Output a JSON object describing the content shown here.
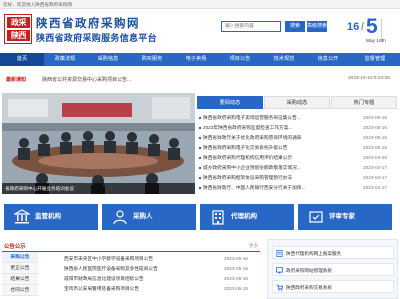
{
  "topbar": {
    "text": "您好，欢迎进入陕西省政府采购网"
  },
  "header": {
    "logo_line1": "政采",
    "logo_line2": "陕西",
    "title_line1": "陕西省政府采购网",
    "title_line2": "陕西省政府采购服务信息平台",
    "search_placeholder": "输入搜索内容",
    "search_button": "搜索",
    "advanced_button": "高级搜索",
    "month": "16",
    "day": "5",
    "date_string": "May 16th"
  },
  "nav": {
    "items": [
      {
        "label": "首页"
      },
      {
        "label": "政策法规"
      },
      {
        "label": "采购信息"
      },
      {
        "label": "购买服务"
      },
      {
        "label": "电子卖场"
      },
      {
        "label": "项目公告"
      },
      {
        "label": "技术规范"
      },
      {
        "label": "信息公开"
      },
      {
        "label": "监督管理"
      }
    ]
  },
  "notice": {
    "label": "最新通知",
    "text": "陕西省公共资源交易中心采购项目公告...",
    "time": "2023-10-10 9:24:35"
  },
  "photo": {
    "caption": "省政府采购中心开展业务培训会议"
  },
  "tabs": [
    {
      "label": "要闻动态"
    },
    {
      "label": "采购动态"
    },
    {
      "label": "热门专题"
    }
  ],
  "news": [
    {
      "title": "陕西省政府采购电子卖场运营服务商征集公告...",
      "date": "2023-05-16"
    },
    {
      "title": "2023年陕西省政府采购监督检查工作方案...",
      "date": "2023-05-16"
    },
    {
      "title": "陕西省财政厅关于优化政府采购营商环境的通知",
      "date": "2023-05-15"
    },
    {
      "title": "陕西省政府采购电子化交易系统升级公告",
      "date": "2023-05-15"
    },
    {
      "title": "陕西省政府采购代理机构信用评价结果公示",
      "date": "2023-04-28"
    },
    {
      "title": "城乡政府采购中小企业预留份额政策落实情况...",
      "date": "2023-04-17"
    },
    {
      "title": "陕西省政府采购框架协议采购管理暂行办法",
      "date": "2023-04-17"
    },
    {
      "title": "陕西省财政厅、中国人民银行西安分行关于加快...",
      "date": "2023-04-17"
    }
  ],
  "quick": [
    {
      "label": "监管机构",
      "icon": "bank-icon"
    },
    {
      "label": "采购人",
      "icon": "person-icon"
    },
    {
      "label": "代理机构",
      "icon": "building-icon"
    },
    {
      "label": "评审专家",
      "icon": "expert-icon"
    }
  ],
  "lower": {
    "title": "公告公示",
    "more": "更多",
    "side_items": [
      {
        "label": "采购公告"
      },
      {
        "label": "更正公告"
      },
      {
        "label": "结果公告"
      },
      {
        "label": "合同公告"
      }
    ],
    "rows": [
      {
        "title": "西安市未央区中小学教学设备采购项目公告",
        "date": "2023-05-16"
      },
      {
        "title": "陕西省人民医院医疗设备采购竞争性磋商公告",
        "date": "2023-05-16"
      },
      {
        "title": "咸阳市财政局信息化建设项目招标公告",
        "date": "2023-05-16"
      },
      {
        "title": "宝鸡市公安局警用装备采购项目公告",
        "date": "2023-05-15"
      }
    ]
  },
  "right_panel": {
    "rows": [
      {
        "label": "陕西代理机构网上备案服务"
      },
      {
        "label": "政府采购网站管理系统"
      },
      {
        "label": "陕西政府采购交易系统"
      }
    ]
  }
}
